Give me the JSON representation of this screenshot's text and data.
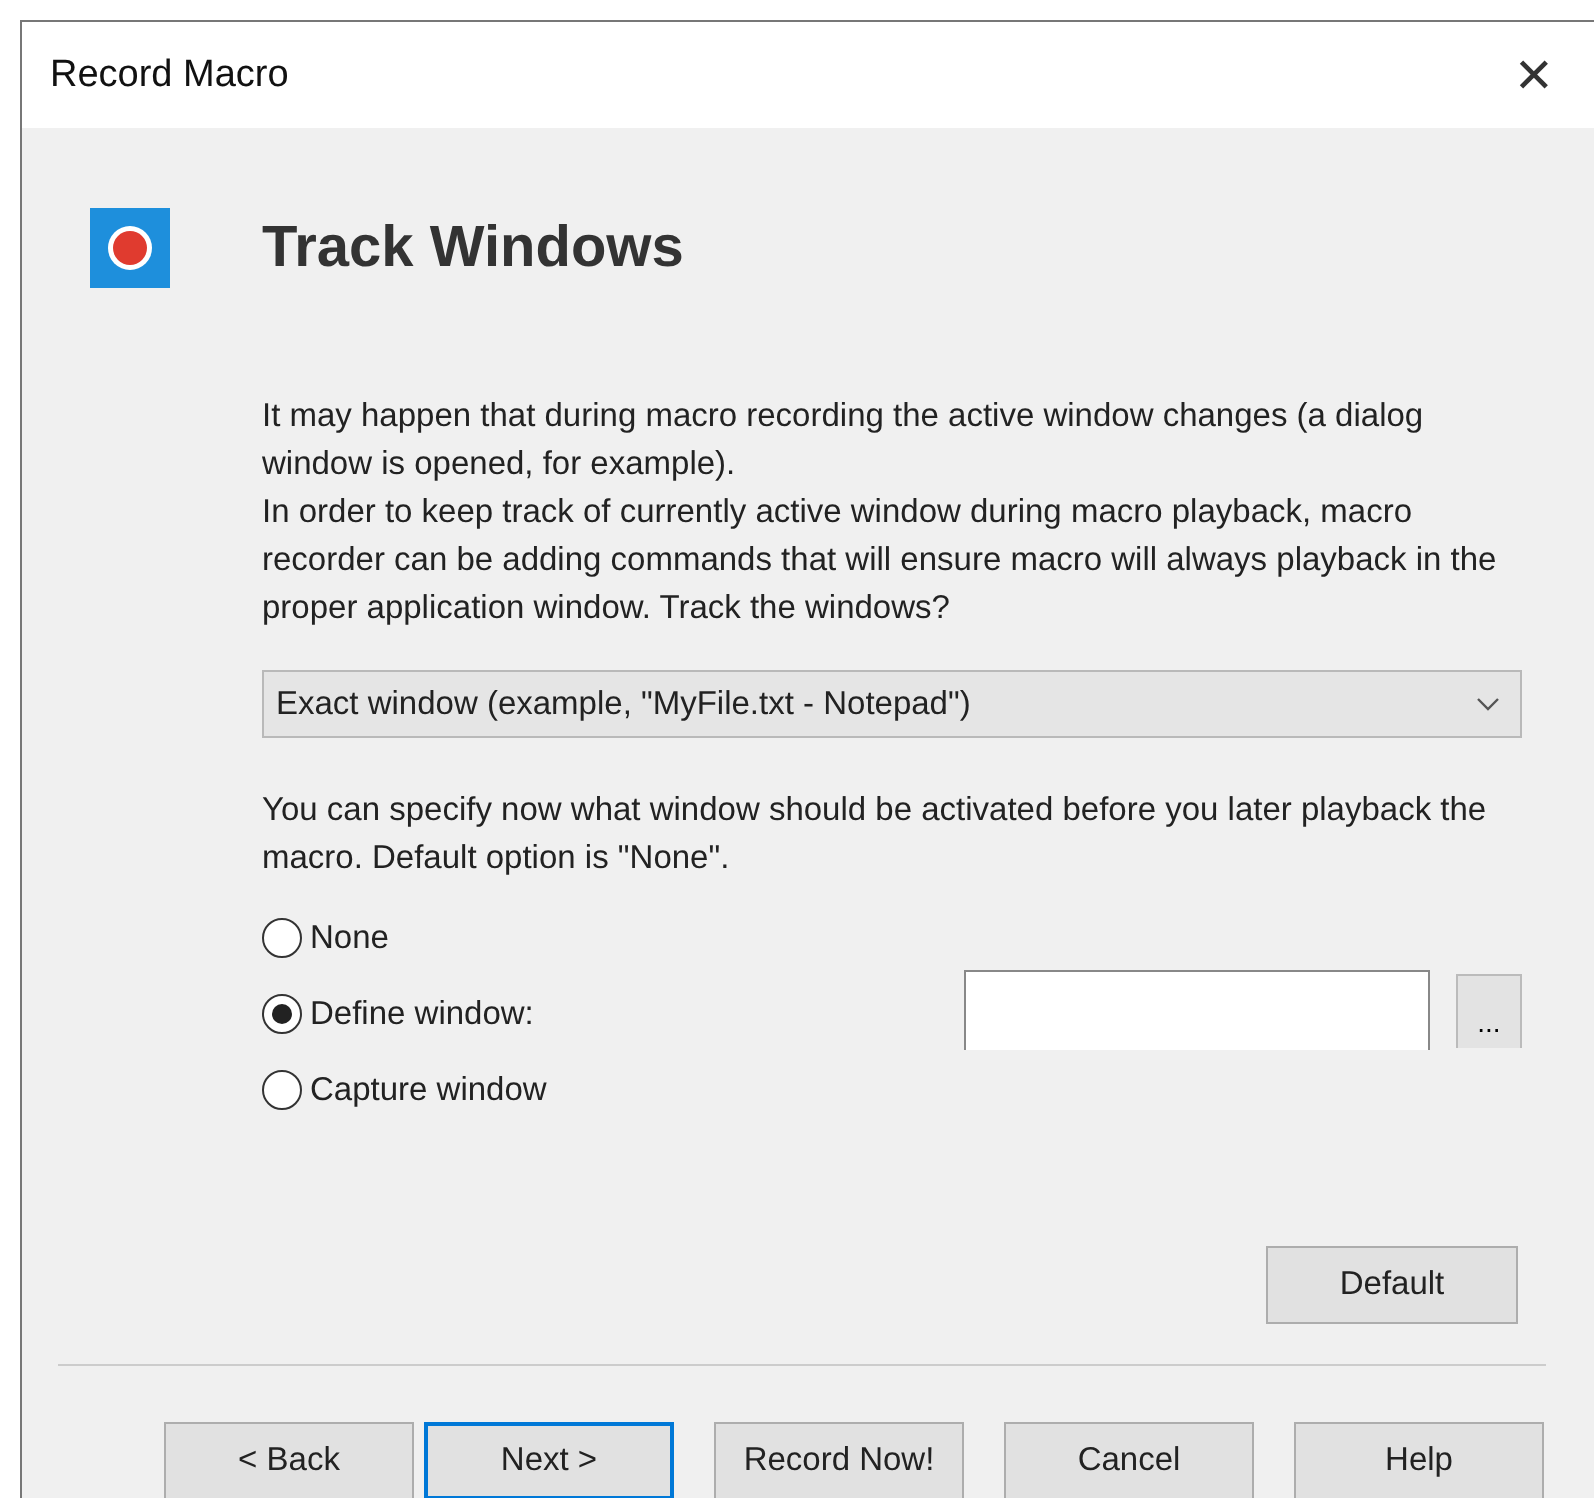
{
  "window": {
    "title": "Record Macro",
    "close": "✕"
  },
  "page": {
    "title": "Track Windows"
  },
  "intro": [
    "It may happen that during macro recording the active window changes (a dialog window is opened, for example).",
    "In order to keep track of currently active window during macro playback, macro recorder can be adding commands that will ensure macro will always playback in the proper application window. Track the windows?"
  ],
  "tracking_dropdown": {
    "value": "Exact window (example, \"MyFile.txt - Notepad\")"
  },
  "hint": "You can specify now what window should be activated before you later playback the macro.  Default option is \"None\".",
  "options": [
    {
      "label": "None",
      "selected": false
    },
    {
      "label": "Define window:",
      "selected": true
    },
    {
      "label": "Capture window",
      "selected": false
    }
  ],
  "browse_button": "...",
  "default_button": "Default",
  "buttons": [
    {
      "label": "< Back",
      "default": false
    },
    {
      "label": "Next >",
      "default": true
    },
    {
      "label": "Record Now!",
      "default": false
    },
    {
      "label": "Cancel",
      "default": false
    },
    {
      "label": "Help",
      "default": false
    }
  ]
}
